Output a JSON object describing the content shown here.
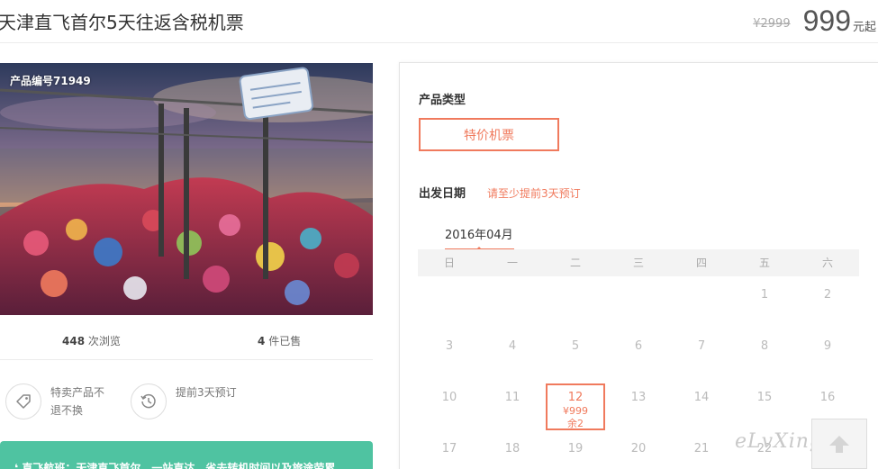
{
  "header": {
    "title": "天津直飞首尔5天往返含税机票",
    "original_price": "¥2999",
    "price": "999",
    "price_unit": "元起"
  },
  "product": {
    "number_label": "产品编号71949",
    "views_count": "448",
    "views_label": "次浏览",
    "sold_count": "4",
    "sold_label": "件已售"
  },
  "features": [
    {
      "icon": "tag-icon",
      "text": "特卖产品不退不换"
    },
    {
      "icon": "clock-history-icon",
      "text": "提前3天预订"
    }
  ],
  "promo": {
    "text": "❛ 直飞航班：天津直飞首尔，一站直达，省去转机时间以及旅途劳累。"
  },
  "booking": {
    "type_label": "产品类型",
    "type_option": "特价机票",
    "date_label": "出发日期",
    "date_note": "请至少提前3天预订",
    "month": "2016年04月",
    "weekdays": [
      "日",
      "一",
      "二",
      "三",
      "四",
      "五",
      "六"
    ],
    "weeks": [
      [
        {
          "d": ""
        },
        {
          "d": ""
        },
        {
          "d": ""
        },
        {
          "d": ""
        },
        {
          "d": ""
        },
        {
          "d": "1"
        },
        {
          "d": "2"
        }
      ],
      [
        {
          "d": "3"
        },
        {
          "d": "4"
        },
        {
          "d": "5"
        },
        {
          "d": "6"
        },
        {
          "d": "7"
        },
        {
          "d": "8"
        },
        {
          "d": "9"
        }
      ],
      [
        {
          "d": "10"
        },
        {
          "d": "11"
        },
        {
          "d": "12",
          "price": "¥999",
          "stock": "余2",
          "available": true
        },
        {
          "d": "13"
        },
        {
          "d": "14"
        },
        {
          "d": "15"
        },
        {
          "d": "16"
        }
      ],
      [
        {
          "d": "17"
        },
        {
          "d": "18"
        },
        {
          "d": "19"
        },
        {
          "d": "20"
        },
        {
          "d": "21"
        },
        {
          "d": "22"
        },
        {
          "d": ""
        }
      ]
    ]
  },
  "watermark": "eLvXing.net",
  "colors": {
    "accent": "#f07a5d",
    "promo_bg": "#4fc3a1"
  }
}
